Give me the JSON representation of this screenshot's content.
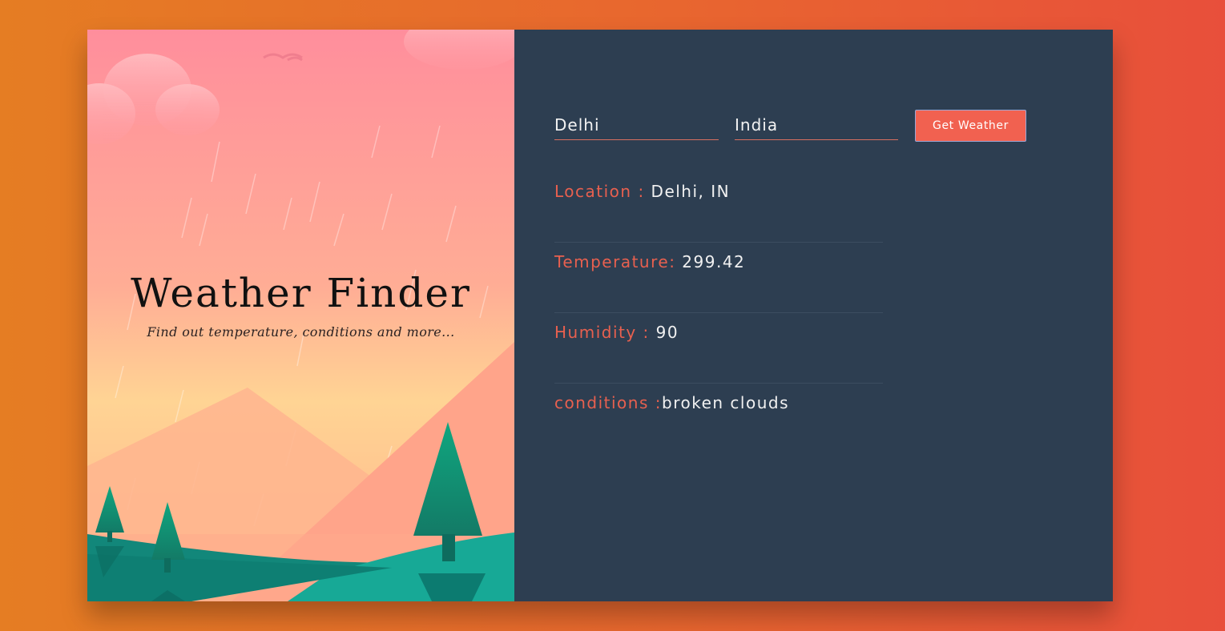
{
  "hero": {
    "title": "Weather Finder",
    "subtitle": "Find out temperature, conditions and more..."
  },
  "form": {
    "city_value": "Delhi",
    "country_value": "India",
    "submit_label": "Get Weather"
  },
  "results": [
    {
      "label": "Location : ",
      "value": "Delhi, IN"
    },
    {
      "label": "Temperature: ",
      "value": "299.42"
    },
    {
      "label": "Humidity : ",
      "value": "90"
    },
    {
      "label": "conditions :",
      "value": "broken clouds"
    }
  ],
  "colors": {
    "accent": "#f16150",
    "panel": "#2d3e51",
    "label": "#e8604f"
  }
}
